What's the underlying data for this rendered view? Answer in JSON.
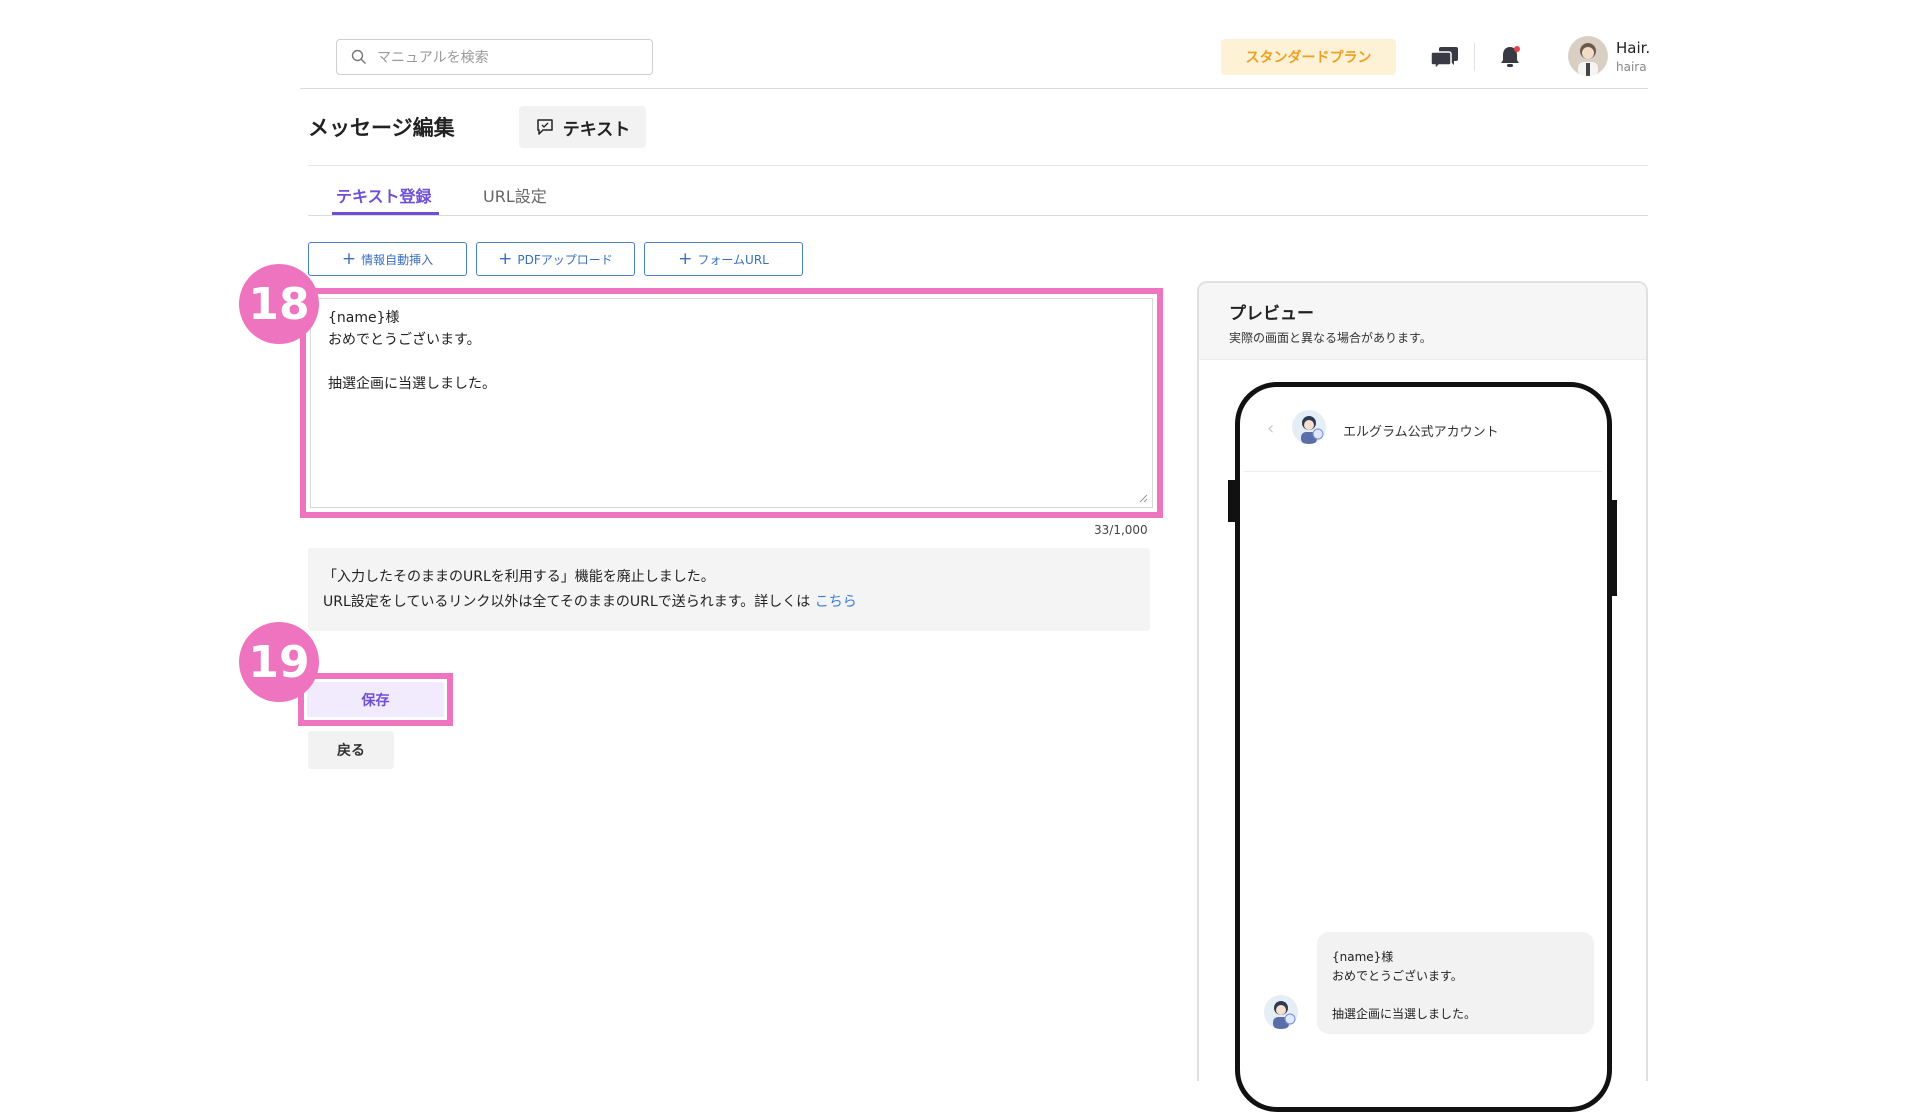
{
  "header": {
    "search_placeholder": "マニュアルを検索",
    "plan_label": "スタンダードプラン",
    "user_name": "Hair.",
    "user_id": "haira"
  },
  "page": {
    "title": "メッセージ編集",
    "message_type": "テキスト"
  },
  "tabs": [
    {
      "label": "テキスト登録",
      "active": true
    },
    {
      "label": "URL設定",
      "active": false
    }
  ],
  "insert_buttons": [
    {
      "label": "情報自動挿入"
    },
    {
      "label": "PDFアップロード"
    },
    {
      "label": "フォームURL"
    }
  ],
  "editor": {
    "lines": [
      "{name}様",
      "おめでとうございます。",
      "",
      "抽選企画に当選しました。"
    ],
    "counter": "33/1,000"
  },
  "notice": {
    "line1": "「入力したそのままのURLを利用する」機能を廃止しました。",
    "line2": "URL設定をしているリンク以外は全てそのままのURLで送られます。詳しくは",
    "link_text": "こちら"
  },
  "actions": {
    "save_label": "保存",
    "back_label": "戻る"
  },
  "steps": {
    "editor_step": "18",
    "save_step": "19"
  },
  "preview": {
    "title": "プレビュー",
    "subtitle": "実際の画面と異なる場合があります。",
    "account_name": "エルグラム公式アカウント",
    "bubble_lines": [
      "{name}様",
      "おめでとうございます。",
      "",
      "抽選企画に当選しました。"
    ]
  },
  "colors": {
    "accent": "#6f4fd6",
    "highlight": "#ef74bf",
    "link": "#3a7fd0",
    "plan_text": "#f0a020",
    "notification_dot": "#e8424a"
  },
  "icons": [
    "search-icon",
    "chat-icon",
    "bell-icon",
    "comment-icon",
    "plus-icon",
    "chevron-left-icon",
    "resize-handle-icon"
  ]
}
